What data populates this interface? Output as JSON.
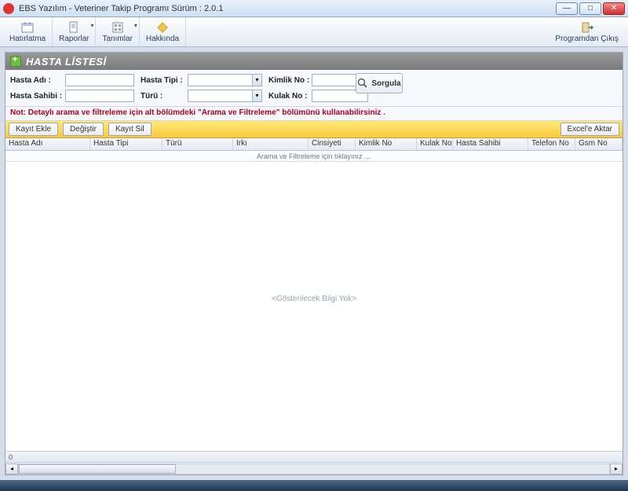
{
  "window": {
    "title": "EBS Yazılım - Veteriner Takip Programı Sürüm : 2.0.1"
  },
  "toolbar": {
    "hatirlatma": "Hatırlatma",
    "raporlar": "Raporlar",
    "tanimlar": "Tanımlar",
    "hakkinda": "Hakkında",
    "cikis": "Programdan Çıkış"
  },
  "panel": {
    "title": "HASTA LİSTESİ"
  },
  "form": {
    "hasta_adi_label": "Hasta Adı :",
    "hasta_adi_value": "",
    "hasta_sahibi_label": "Hasta Sahibi :",
    "hasta_sahibi_value": "",
    "hasta_tipi_label": "Hasta Tipi :",
    "hasta_tipi_value": "",
    "turu_label": "Türü :",
    "turu_value": "",
    "kimlik_no_label": "Kimlik No :",
    "kimlik_no_value": "",
    "kulak_no_label": "Kulak No :",
    "kulak_no_value": "",
    "sorgula": "Sorgula",
    "note": "Not: Detaylı arama ve filtreleme için alt bölümdeki \"Arama ve Filtreleme\" bölümünü kullanabilirsiniz ."
  },
  "actions": {
    "kayit_ekle": "Kayıt Ekle",
    "degistir": "Değiştir",
    "kayit_sil": "Kayıt Sil",
    "excel": "Excel'e Aktar"
  },
  "grid": {
    "columns": [
      "Hasta Adı",
      "Hasta Tipi",
      "Türü",
      "Irkı",
      "Cinsiyeti",
      "Kimlik No",
      "Kulak No",
      "Hasta Sahibi",
      "Telefon No",
      "Gsm No"
    ],
    "filter_hint": "Arama ve Filtreleme için tıklayınız …",
    "no_data": "<Gösterilecek Bilgi Yok>",
    "row_count": "0"
  }
}
